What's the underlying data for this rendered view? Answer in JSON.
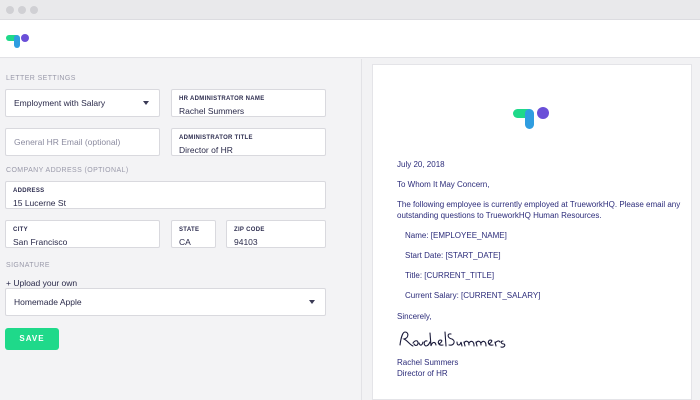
{
  "form": {
    "section_letter_settings": "LETTER SETTINGS",
    "letter_type": "Employment with Salary",
    "hr_admin_name_label": "HR ADMINISTRATOR NAME",
    "hr_admin_name_value": "Rachel Summers",
    "hr_email_placeholder": "General HR Email (optional)",
    "admin_title_label": "ADMINISTRATOR TITLE",
    "admin_title_value": "Director of HR",
    "section_company_address": "COMPANY ADDRESS (OPTIONAL)",
    "address_label": "ADDRESS",
    "address_value": "15 Lucerne St",
    "city_label": "CITY",
    "city_value": "San Francisco",
    "state_label": "STATE",
    "state_value": "CA",
    "zip_label": "ZIP CODE",
    "zip_value": "94103",
    "section_signature": "SIGNATURE",
    "upload_label": "+ Upload your own",
    "signature_option": "Homemade Apple",
    "save_label": "SAVE"
  },
  "letter": {
    "date": "July 20, 2018",
    "salutation": "To Whom It May Concern,",
    "body_line1": "The following employee is currently employed at TrueworkHQ. Please email any",
    "body_line2": "outstanding questions to TrueworkHQ Human Resources.",
    "name_line": "Name: [EMPLOYEE_NAME]",
    "start_line": "Start Date: [START_DATE]",
    "title_line": "Title: [CURRENT_TITLE]",
    "salary_line": "Current Salary: [CURRENT_SALARY]",
    "closing": "Sincerely,",
    "signer_name": "Rachel Summers",
    "signer_title": "Director of HR"
  },
  "colors": {
    "accent_green": "#1fd98a",
    "logo_green": "#1fd98a",
    "logo_blue": "#2f9de0",
    "logo_purple": "#6a4fd8",
    "letter_text": "#2c2c7a"
  },
  "icons": {
    "app_logo": "truework-logo-icon",
    "dropdown": "chevron-down-icon"
  }
}
